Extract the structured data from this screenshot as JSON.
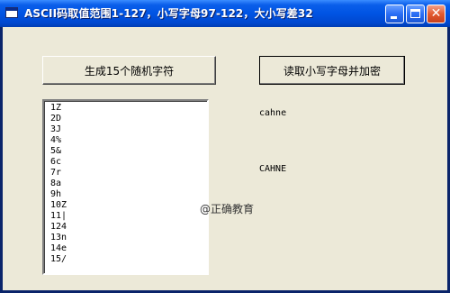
{
  "window": {
    "title": "ASCII码取值范围1-127，小写字母97-122，大小写差32",
    "controls": {
      "minimize": "_",
      "maximize": "□",
      "close": "✕"
    }
  },
  "buttons": {
    "generate_label": "生成15个随机字符",
    "read_encrypt_label": "读取小写字母并加密"
  },
  "listbox": {
    "items": [
      "1Z",
      "2D",
      "3J",
      "4%",
      "5&",
      "6c",
      "7r",
      "8a",
      "9h",
      "10Z",
      "11|",
      "124",
      "13n",
      "14e",
      "15/"
    ]
  },
  "labels": {
    "lowercase_result": "cahne",
    "uppercase_result": "CAHNE"
  },
  "watermark": "@正确教育",
  "colors": {
    "titlebar": "#0054E3",
    "window_bg": "#ECE9D8",
    "close_button": "#E25A2F"
  }
}
